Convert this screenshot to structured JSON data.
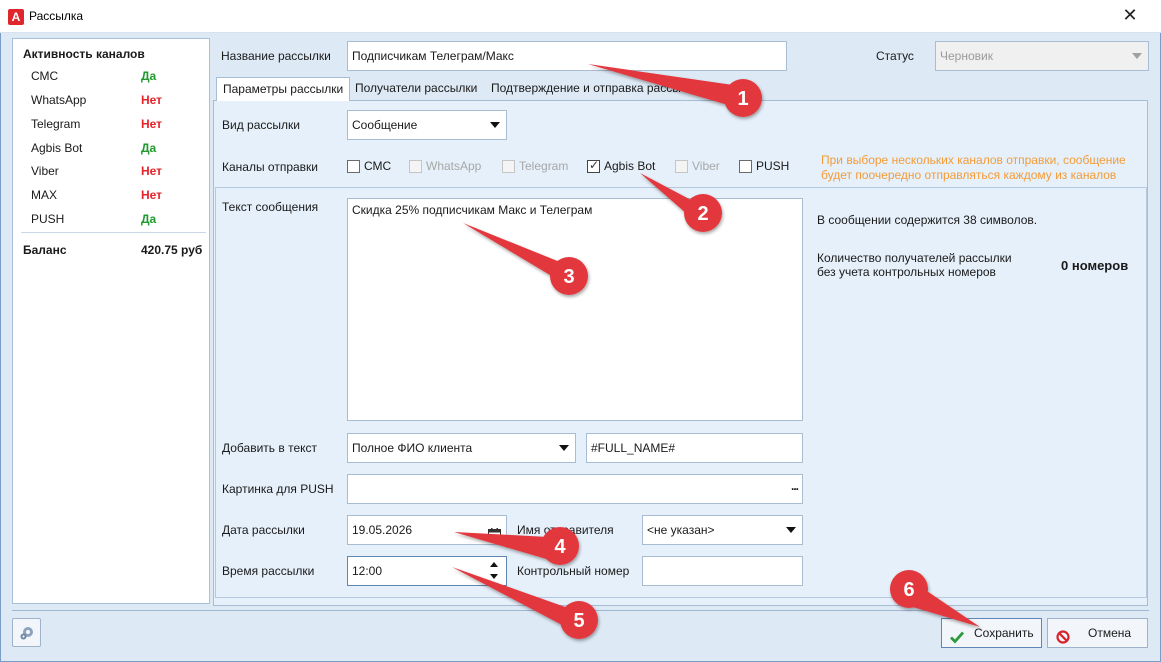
{
  "window": {
    "title": "Рассылка",
    "app_icon_letter": "A",
    "close_glyph": "✕"
  },
  "channels_panel": {
    "title": "Активность каналов",
    "items": [
      {
        "name": "СМС",
        "status": "Да"
      },
      {
        "name": "WhatsApp",
        "status": "Нет"
      },
      {
        "name": "Telegram",
        "status": "Нет"
      },
      {
        "name": "Agbis Bot",
        "status": "Да"
      },
      {
        "name": "Viber",
        "status": "Нет"
      },
      {
        "name": "MAX",
        "status": "Нет"
      },
      {
        "name": "PUSH",
        "status": "Да"
      }
    ],
    "balance_label": "Баланс",
    "balance_value": "420.75 руб"
  },
  "header": {
    "name_label": "Название рассылки",
    "name_value": "Подписчикам Телеграм/Макс",
    "status_label": "Статус",
    "status_value": "Черновик"
  },
  "tabs": [
    {
      "label": "Параметры рассылки"
    },
    {
      "label": "Получатели рассылки"
    },
    {
      "label": "Подтверждение и отправка рассы"
    }
  ],
  "params": {
    "type_label": "Вид рассылки",
    "type_value": "Сообщение",
    "channels_label": "Каналы отправки",
    "channels": [
      {
        "label": "СМС",
        "checked": false,
        "enabled": true
      },
      {
        "label": "WhatsApp",
        "checked": false,
        "enabled": false
      },
      {
        "label": "Telegram",
        "checked": false,
        "enabled": false
      },
      {
        "label": "Agbis Bot",
        "checked": true,
        "enabled": true
      },
      {
        "label": "Viber",
        "checked": false,
        "enabled": false
      },
      {
        "label": "PUSH",
        "checked": false,
        "enabled": true
      }
    ],
    "channels_hint_line1": "При выборе нескольких каналов отправки, сообщение",
    "channels_hint_line2": "будет поочередно отправляться каждому из каналов",
    "message_label": "Текст сообщения",
    "message_value": "Скидка 25% подписчикам Макс и Телеграм",
    "symbols_info": "В сообщении содержится 38 символов.",
    "recipients_label_line1": "Количество получателей рассылки",
    "recipients_label_line2": "без учета контрольных номеров",
    "recipients_value": "0 номеров",
    "add_text_label": "Добавить в текст",
    "add_text_value": "Полное ФИО клиента",
    "add_text_token": "#FULL_NAME#",
    "push_image_label": "Картинка для PUSH",
    "push_image_button": "...",
    "date_label": "Дата рассылки",
    "date_value": "19.05.2026",
    "sender_label": "Имя отправителя",
    "sender_value": "<не указан>",
    "time_label": "Время рассылки",
    "time_value": "12:00",
    "control_label": "Контрольный номер",
    "control_value": ""
  },
  "footer": {
    "save_label": "Сохранить",
    "cancel_label": "Отмена"
  },
  "callouts": [
    "1",
    "2",
    "3",
    "4",
    "5",
    "6"
  ],
  "colors": {
    "yes": "#1f9a2e",
    "no": "#e4232a",
    "hint": "#f29c38",
    "callout": "#e2373d"
  },
  "icons": [
    "app-logo-icon",
    "close-icon",
    "settings-icon",
    "calendar-icon",
    "checkmark-icon",
    "cancel-icon"
  ]
}
